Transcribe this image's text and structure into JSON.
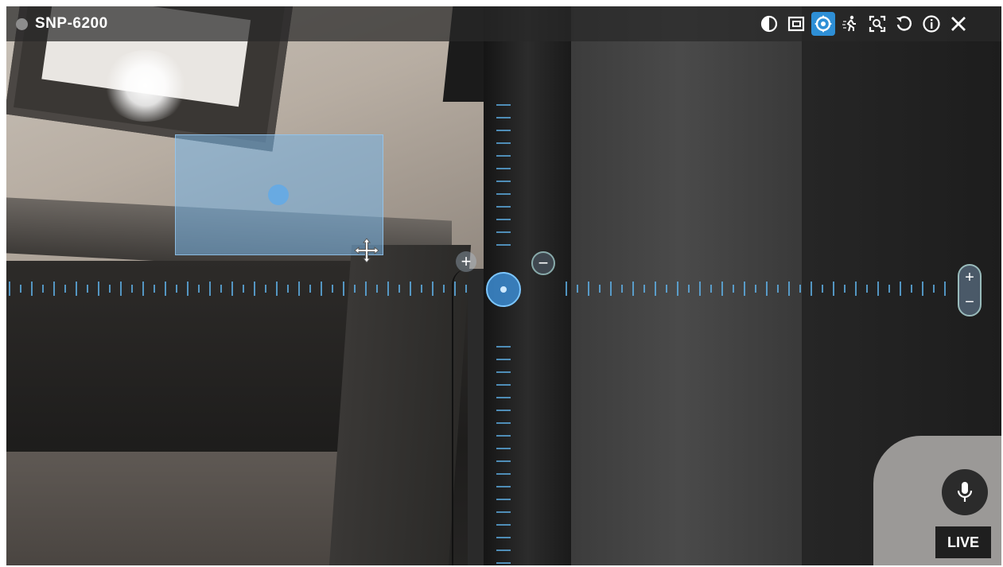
{
  "camera": {
    "name": "SNP-6200",
    "status": "offline-grey"
  },
  "toolbar": {
    "icons": [
      {
        "name": "contrast-icon",
        "active": false
      },
      {
        "name": "picture-in-picture-icon",
        "active": false
      },
      {
        "name": "ptz-control-icon",
        "active": true
      },
      {
        "name": "motion-tracking-icon",
        "active": false
      },
      {
        "name": "area-zoom-icon",
        "active": false
      },
      {
        "name": "refresh-icon",
        "active": false
      },
      {
        "name": "info-icon",
        "active": false
      },
      {
        "name": "close-icon",
        "active": false
      }
    ],
    "accent_color": "#2e8fd6"
  },
  "overlay": {
    "zoom_plus": "+",
    "zoom_minus": "−",
    "pan_plus": "+",
    "pan_minus": "−"
  },
  "footer": {
    "mic_icon": "microphone-icon",
    "live_label": "LIVE"
  }
}
